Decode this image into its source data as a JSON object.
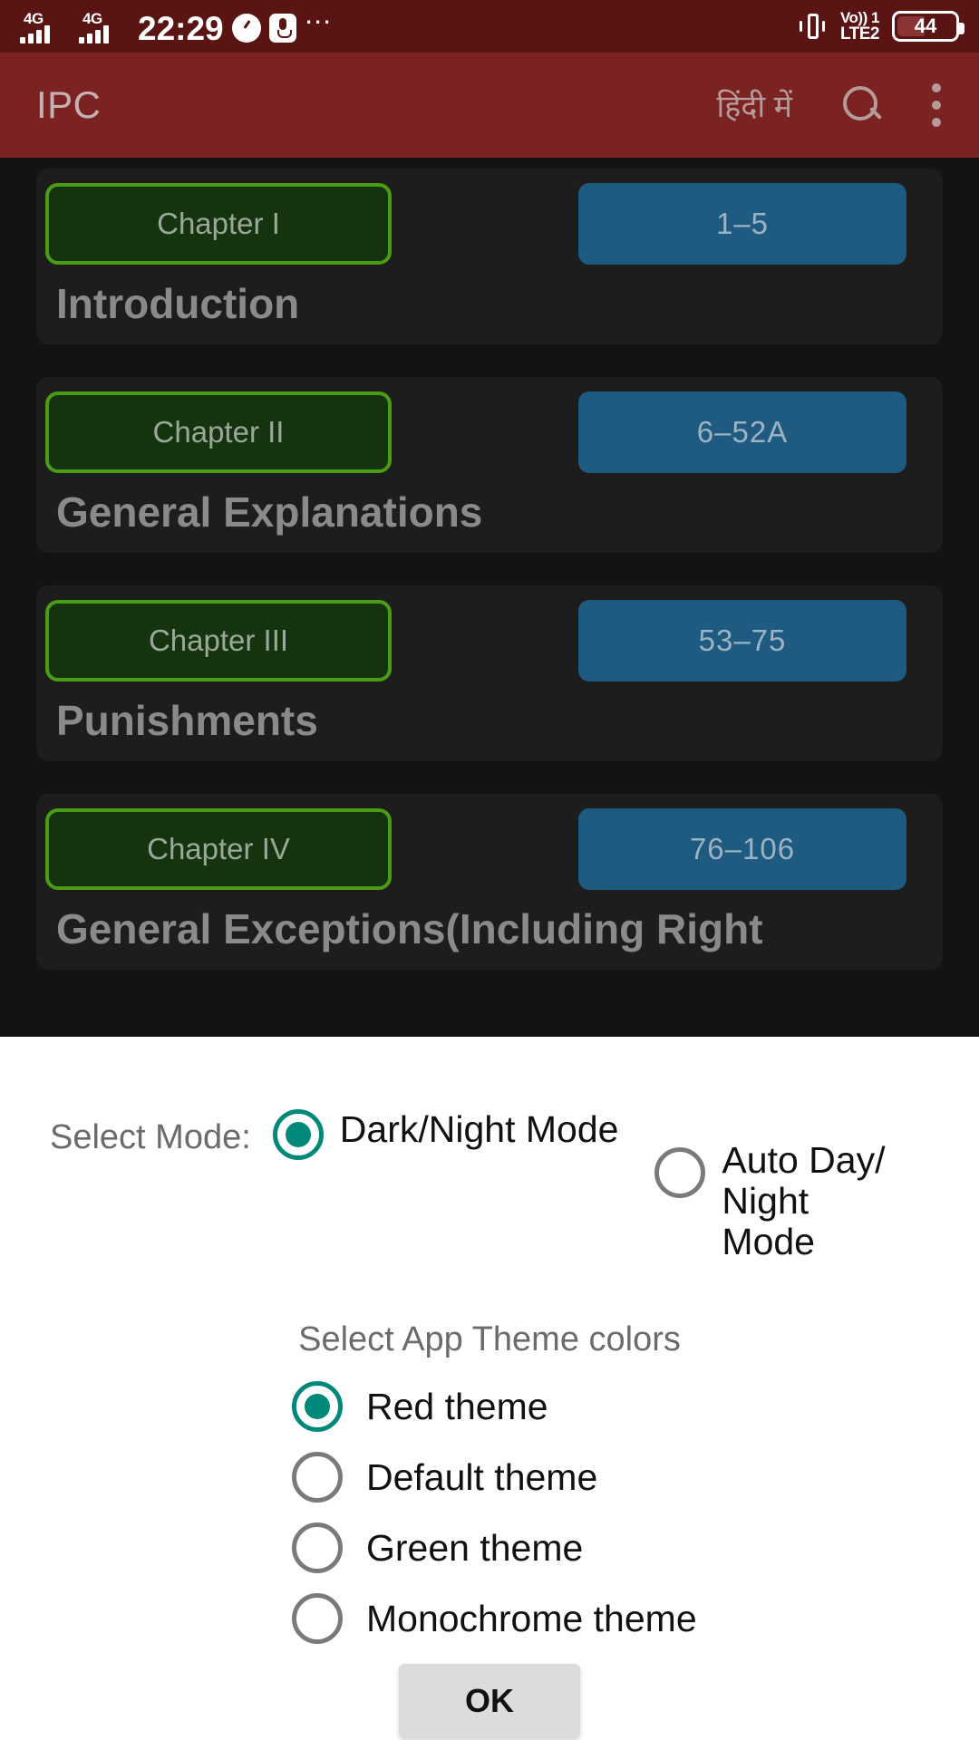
{
  "status_bar": {
    "network_label_1": "4G",
    "network_label_2": "4G",
    "time": "22:29",
    "icons": [
      "speedometer-icon",
      "microphone-icon",
      "more-dots-icon",
      "vibrate-icon"
    ],
    "volte_top": "Vo)) 1",
    "volte_bottom": "LTE2",
    "battery_percent": "44",
    "background_color": "#5A1414"
  },
  "app_bar": {
    "title": "IPC",
    "language_toggle": "हिंदी में",
    "search_icon": "search-icon",
    "overflow_icon": "kebab-menu-icon",
    "background_color": "#7B2222"
  },
  "chapter_list": {
    "chapters": [
      {
        "chapter": "Chapter I",
        "range": "1–5",
        "title": "Introduction"
      },
      {
        "chapter": "Chapter II",
        "range": "6–52A",
        "title": "General Explanations"
      },
      {
        "chapter": "Chapter III",
        "range": "53–75",
        "title": "Punishments"
      },
      {
        "chapter": "Chapter IV",
        "range": "76–106",
        "title": "General Exceptions(Including Right"
      }
    ],
    "chip_border_color": "#4A9C14",
    "chip_fill_color": "#16330F",
    "range_color": "#1F5A80"
  },
  "dialog": {
    "mode_label": "Select Mode:",
    "mode_options": [
      {
        "label": "Dark/Night Mode",
        "selected": true
      },
      {
        "label": "Auto Day/\nNight\nMode",
        "selected": false
      }
    ],
    "theme_heading": "Select App Theme colors",
    "theme_options": [
      {
        "label": "Red theme",
        "selected": true
      },
      {
        "label": "Default theme",
        "selected": false
      },
      {
        "label": "Green theme",
        "selected": false
      },
      {
        "label": "Monochrome theme",
        "selected": false
      }
    ],
    "ok_label": "OK",
    "accent_color": "#00897B"
  }
}
